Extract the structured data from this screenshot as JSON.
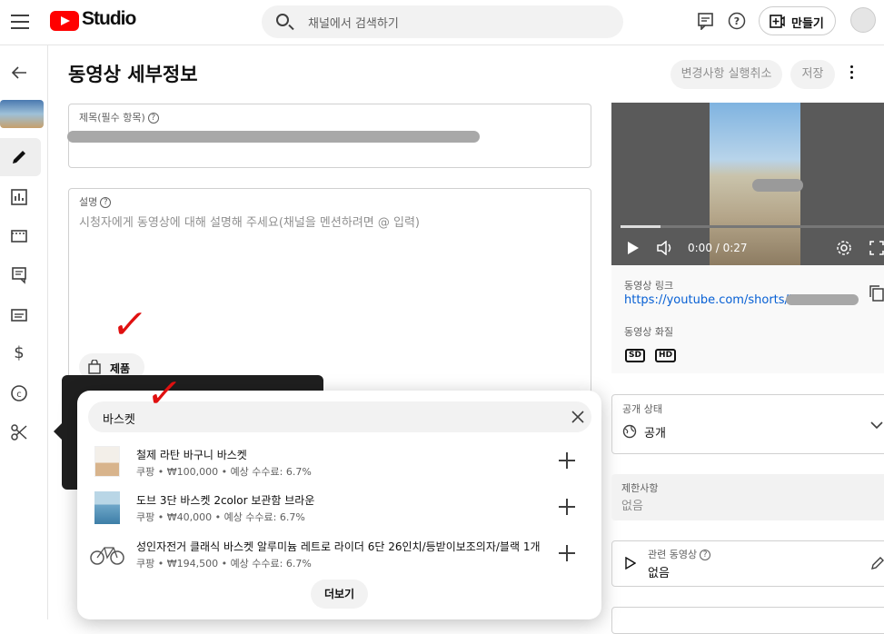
{
  "header": {
    "logo_text": "Studio",
    "search_placeholder": "채널에서 검색하기",
    "create_label": "만들기"
  },
  "page": {
    "title": "동영상 세부정보",
    "undo_label": "변경사항 실행취소",
    "save_label": "저장"
  },
  "title_field": {
    "label": "제목(필수 항목)"
  },
  "description_field": {
    "label": "설명",
    "placeholder": "시청자에게 동영상에 대해 설명해 주세요(채널을 멘션하려면 @ 입력)"
  },
  "products_chip": {
    "label": "제품"
  },
  "product_search": {
    "query": "바스켓",
    "results": [
      {
        "title": "철제 라탄 바구니 바스켓",
        "meta": "쿠팡 • ₩100,000 • 예상 수수료: 6.7%"
      },
      {
        "title": "도브 3단 바스켓 2color 보관함 브라운",
        "meta": "쿠팡 • ₩40,000 • 예상 수수료: 6.7%"
      },
      {
        "title": "성인자전거 클래식 바스켓 알루미늄 레트로 라이더 6단 26인치/등받이보조의자/블랙 1개",
        "meta": "쿠팡 • ₩194,500 • 예상 수수료: 6.7%"
      }
    ],
    "more_label": "더보기"
  },
  "video_panel": {
    "time": "0:00 / 0:27",
    "progress": 0.15,
    "link_label": "동영상 링크",
    "link_url": "https://youtube.com/shorts/k",
    "quality_label": "동영상 화질",
    "quality_badges": [
      "SD",
      "HD"
    ]
  },
  "visibility": {
    "label": "공개 상태",
    "value": "공개"
  },
  "restrictions": {
    "label": "제한사항",
    "value": "없음"
  },
  "related_video": {
    "label": "관련 동영상",
    "value": "없음"
  },
  "colors": {
    "brand_red": "#ff0000",
    "link_blue": "#065fd4",
    "check_red": "#e01010"
  },
  "icons": [
    "menu-icon",
    "feedback-icon",
    "help-icon",
    "create-icon",
    "back-icon",
    "edit-icon",
    "analytics-icon",
    "editor-icon",
    "comments-icon",
    "subtitles-icon",
    "monetization-icon",
    "copyright-icon",
    "clips-icon"
  ]
}
